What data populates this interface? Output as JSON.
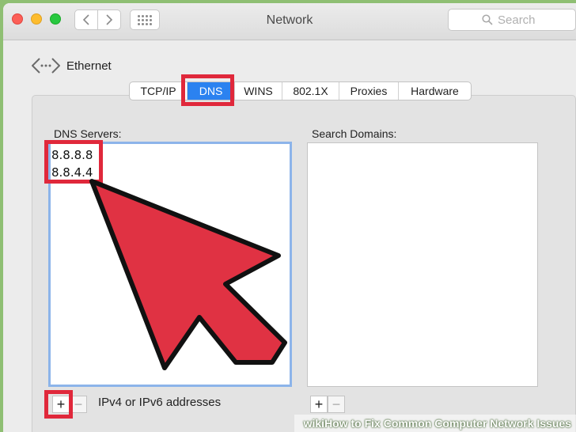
{
  "window": {
    "title": "Network",
    "search_placeholder": "Search"
  },
  "nav": {
    "back_icon": "chevron-left-icon",
    "forward_icon": "chevron-right-icon",
    "grid_icon": "grid-icon"
  },
  "back_link": {
    "label": "Ethernet",
    "icon": "network-arrows-icon"
  },
  "tabs": [
    {
      "label": "TCP/IP",
      "active": false
    },
    {
      "label": "DNS",
      "active": true
    },
    {
      "label": "WINS",
      "active": false
    },
    {
      "label": "802.1X",
      "active": false
    },
    {
      "label": "Proxies",
      "active": false
    },
    {
      "label": "Hardware",
      "active": false
    }
  ],
  "dns": {
    "label": "DNS Servers:",
    "entries": [
      "8.8.8.8",
      "8.8.4.4"
    ],
    "add_label": "+",
    "remove_label": "−",
    "hint": "IPv4 or IPv6 addresses"
  },
  "domains": {
    "label": "Search Domains:",
    "add_label": "+",
    "remove_label": "−"
  },
  "annotations": {
    "highlight_color": "#e0283b",
    "arrow_color": "#e03243"
  },
  "watermark": {
    "text": "wikiHow to Fix Common Computer Network Issues"
  },
  "colors": {
    "accent": "#2b82f0",
    "focus_border": "#8cb4ea",
    "background": "#8fbf73"
  }
}
